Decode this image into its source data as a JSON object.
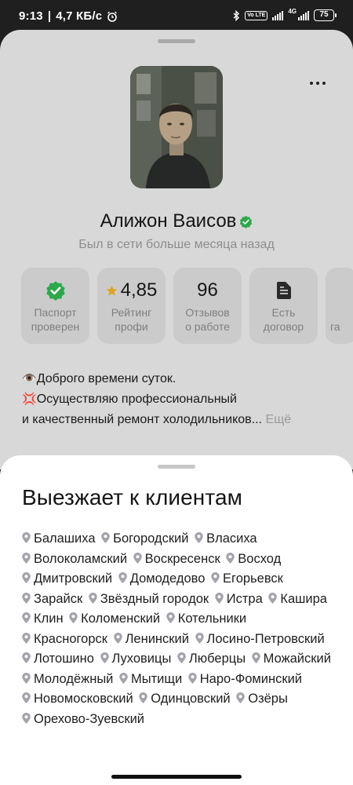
{
  "status_bar": {
    "time": "9:13",
    "speed": "4,7 КБ/с",
    "battery": "75",
    "network": "4G",
    "volte": "Vo LTE"
  },
  "profile": {
    "name": "Алижон Ваисов",
    "last_seen": "Был в сети больше месяца назад",
    "stats": [
      {
        "value": "",
        "label_line1": "Паспорт",
        "label_line2": "проверен",
        "icon": "verified-check-icon"
      },
      {
        "value": "4,85",
        "label_line1": "Рейтинг",
        "label_line2": "профи",
        "icon": "star-icon"
      },
      {
        "value": "96",
        "label_line1": "Отзывов",
        "label_line2": "о работе"
      },
      {
        "value": "",
        "label_line1": "Есть",
        "label_line2": "договор",
        "icon": "document-icon"
      }
    ],
    "partial_card_text": "га",
    "about_line1": "Доброго времени суток.",
    "about_line2": "Осуществляю профессиональный",
    "about_line3": "и качественный ремонт холодильников...",
    "about_more": "Ещё",
    "accent_color": "#2ba84a"
  },
  "sheet": {
    "title": "Выезжает к клиентам",
    "cities": [
      "Балашиха",
      "Богородский",
      "Власиха",
      "Волоколамский",
      "Воскресенск",
      "Восход",
      "Дмитровский",
      "Домодедово",
      "Егорьевск",
      "Зарайск",
      "Звёздный городок",
      "Истра",
      "Кашира",
      "Клин",
      "Коломенский",
      "Котельники",
      "Красногорск",
      "Ленинский",
      "Лосино-Петровский",
      "Лотошино",
      "Луховицы",
      "Люберцы",
      "Можайский",
      "Молодёжный",
      "Мытищи",
      "Наро-Фоминский",
      "Новомосковский",
      "Одинцовский",
      "Озёры",
      "Орехово-Зуевский"
    ]
  }
}
